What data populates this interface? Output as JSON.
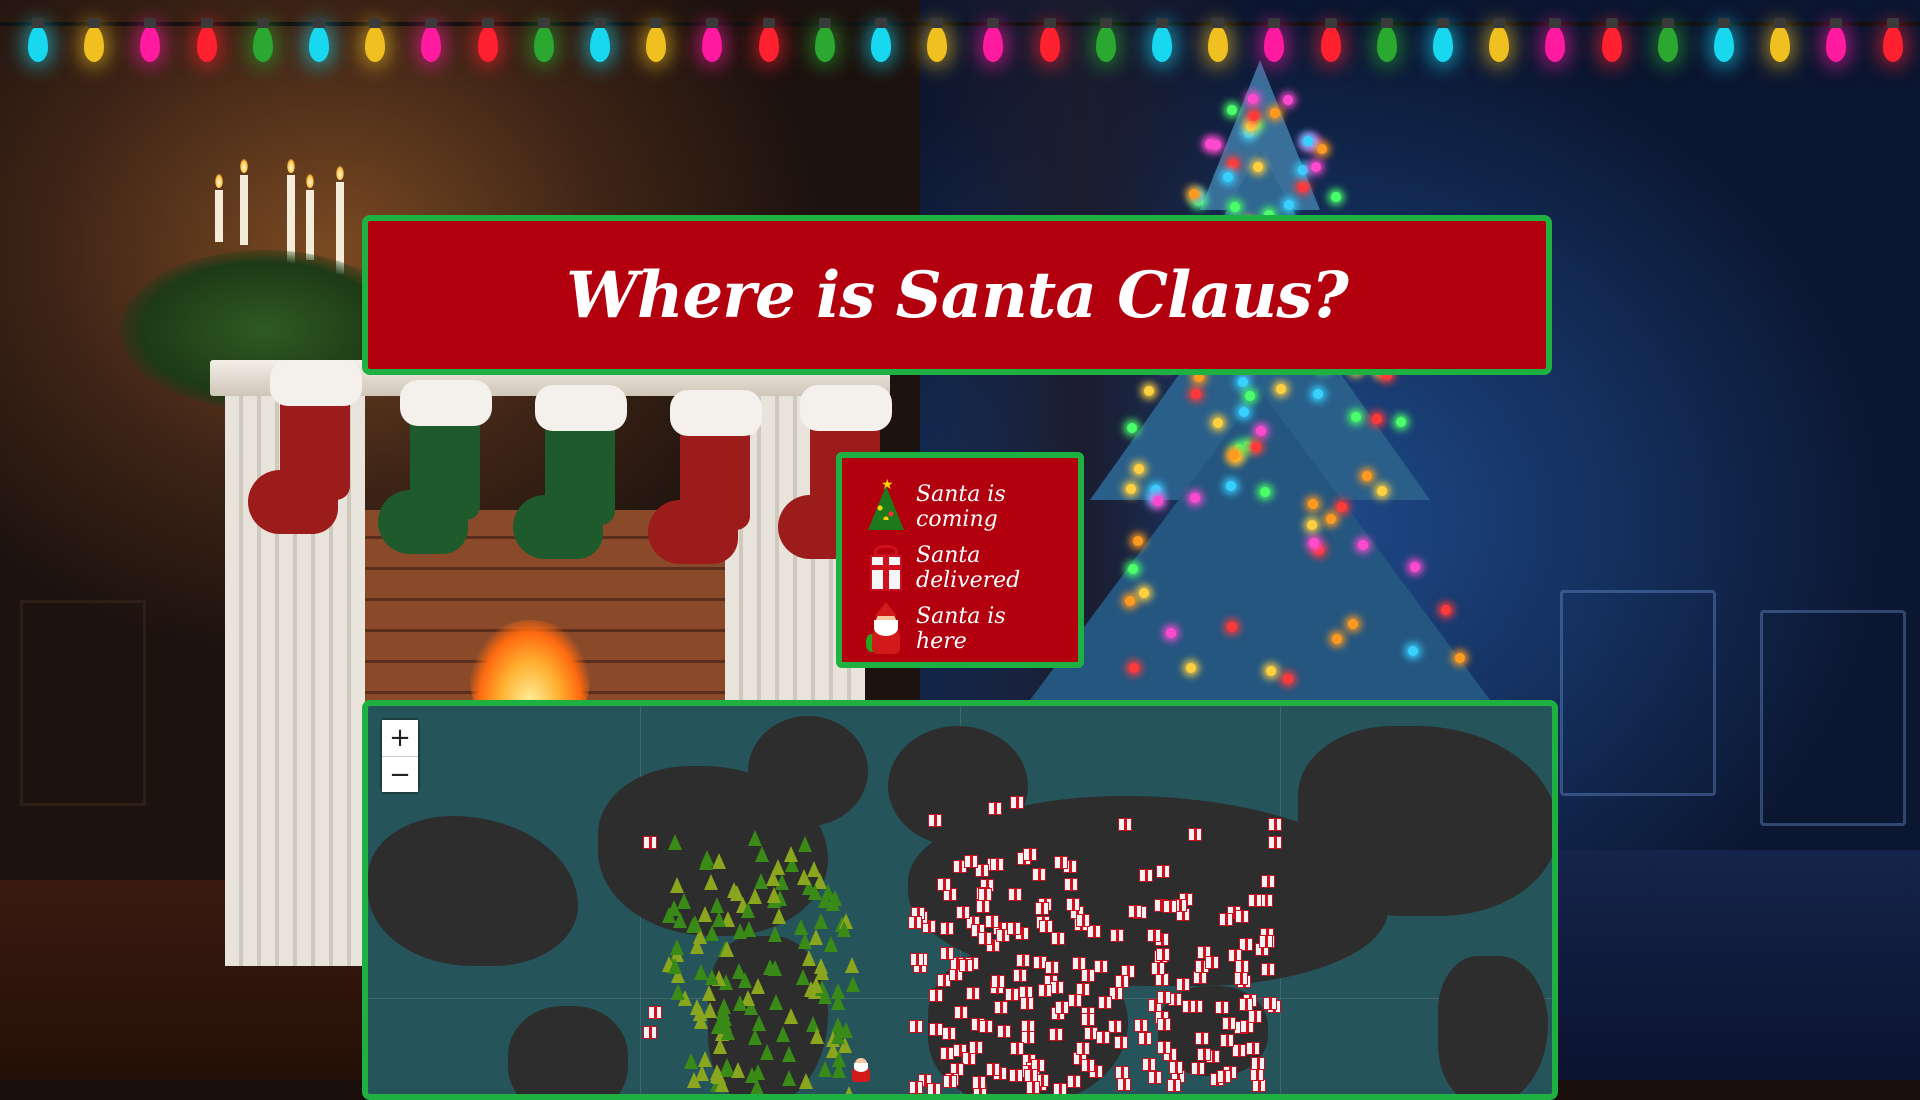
{
  "page": {
    "title": "Where is Santa Claus?"
  },
  "legend": {
    "items": [
      {
        "label": "Santa is coming",
        "icon": "christmas-tree-icon"
      },
      {
        "label": "Santa delivered",
        "icon": "gift-icon"
      },
      {
        "label": "Santa is here",
        "icon": "santa-icon"
      }
    ]
  },
  "map": {
    "zoom_in_label": "+",
    "zoom_out_label": "−",
    "marker_types": [
      "christmas-tree-icon",
      "gift-icon",
      "santa-icon"
    ]
  },
  "colors": {
    "banner_red": "#b3000f",
    "frame_green": "#1eb141",
    "map_ocean": "#25545a",
    "map_land": "#2d2d2d"
  }
}
